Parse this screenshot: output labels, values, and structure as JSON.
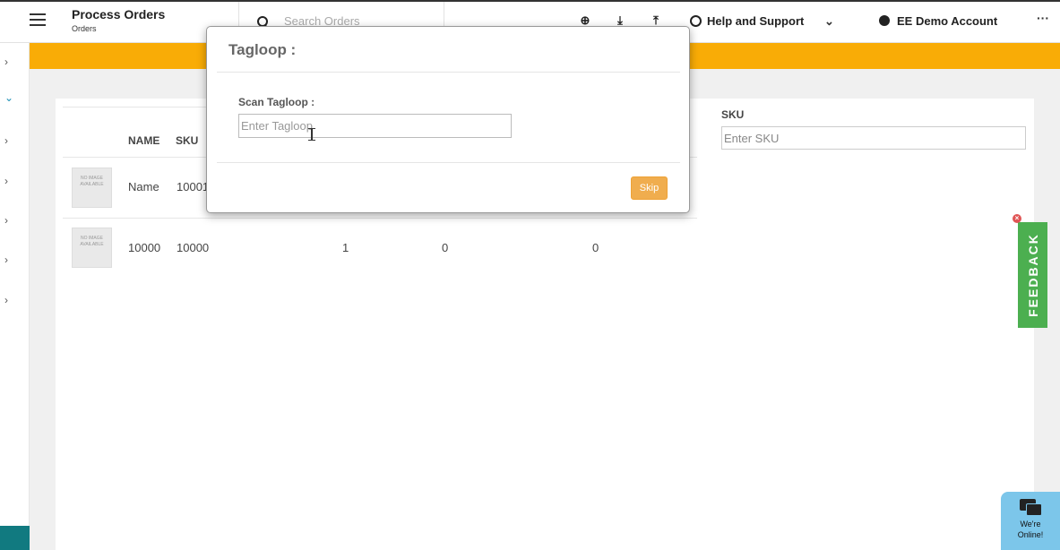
{
  "header": {
    "title": "Process Orders",
    "subtitle": "Orders",
    "search_placeholder": "Search Orders",
    "add_icon": "add-circle-icon",
    "download_icon": "download-icon",
    "upload_icon": "upload-icon",
    "help_label": "Help and Support",
    "account_label": "EE Demo Account",
    "more_label": "···"
  },
  "sidebar": {
    "chevrons": [
      "›",
      "⌄",
      "›",
      "›",
      "›",
      "›",
      "›"
    ]
  },
  "colors": {
    "accent": "#f9ac06",
    "sidebar_bottom": "#117a80",
    "feedback": "#4caf50",
    "skip_button": "#f0ad4e",
    "chat": "#7cc6ea"
  },
  "table": {
    "headers": {
      "name": "NAME",
      "sku": "SKU"
    },
    "thumb_text": "NO IMAGE AVAILABLE",
    "rows": [
      {
        "name": "Name",
        "sku": "10001",
        "c3": "",
        "c4": "",
        "c5": ""
      },
      {
        "name": "10000",
        "sku": "10000",
        "c3": "1",
        "c4": "0",
        "c5": "0"
      }
    ]
  },
  "sku_filter": {
    "label": "SKU",
    "placeholder": "Enter SKU"
  },
  "feedback": {
    "label": "FEEDBACK",
    "close": "×"
  },
  "chat": {
    "line1": "We're",
    "line2": "Online!"
  },
  "modal": {
    "title": "Tagloop :",
    "field_label": "Scan Tagloop :",
    "field_placeholder": "Enter Tagloop",
    "skip_label": "Skip"
  }
}
